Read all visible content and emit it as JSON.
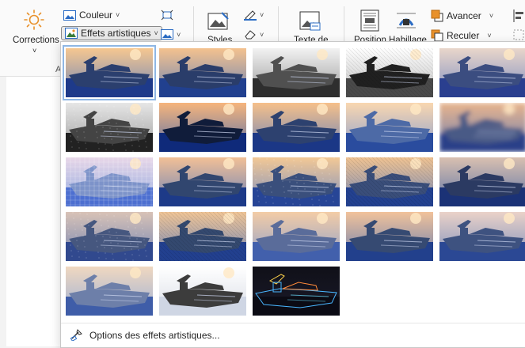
{
  "ribbon": {
    "corrections_label": "Corrections",
    "corrections_caret": "˅",
    "color_label": "Couleur",
    "effects_label": "Effets artistiques",
    "styles_label": "Styles",
    "text_label": "Texte de",
    "position_label": "Position",
    "wrap_label": "Habillage",
    "forward_label": "Avancer",
    "backward_label": "Reculer",
    "group_letter": "A"
  },
  "gallery": {
    "effects": [
      {
        "effect": "none",
        "selected": true
      },
      {
        "effect": "none2",
        "selected": false
      },
      {
        "effect": "pencil-gray",
        "selected": false
      },
      {
        "effect": "pencil-sketch",
        "selected": false
      },
      {
        "effect": "line-drawing",
        "selected": false
      },
      {
        "effect": "chalk",
        "selected": false
      },
      {
        "effect": "paint-strokes",
        "selected": false
      },
      {
        "effect": "paint-brush",
        "selected": false
      },
      {
        "effect": "glow",
        "selected": false
      },
      {
        "effect": "blur",
        "selected": false
      },
      {
        "effect": "mosaic",
        "selected": false
      },
      {
        "effect": "marker",
        "selected": false
      },
      {
        "effect": "film-grain",
        "selected": false
      },
      {
        "effect": "texturizer",
        "selected": false
      },
      {
        "effect": "glass",
        "selected": false
      },
      {
        "effect": "cement",
        "selected": false
      },
      {
        "effect": "crisscross",
        "selected": false
      },
      {
        "effect": "pastels",
        "selected": false
      },
      {
        "effect": "cutout",
        "selected": false
      },
      {
        "effect": "plastic-wrap",
        "selected": false
      },
      {
        "effect": "photocopy",
        "selected": false
      },
      {
        "effect": "light-screen",
        "selected": false
      },
      {
        "effect": "glow-edges",
        "selected": false
      }
    ]
  },
  "options": {
    "label": "Options des effets artistiques..."
  },
  "colors": {
    "selected_outline": "#8fb7e4",
    "accent_orange": "#e8912b",
    "accent_blue": "#2b6cc4"
  }
}
